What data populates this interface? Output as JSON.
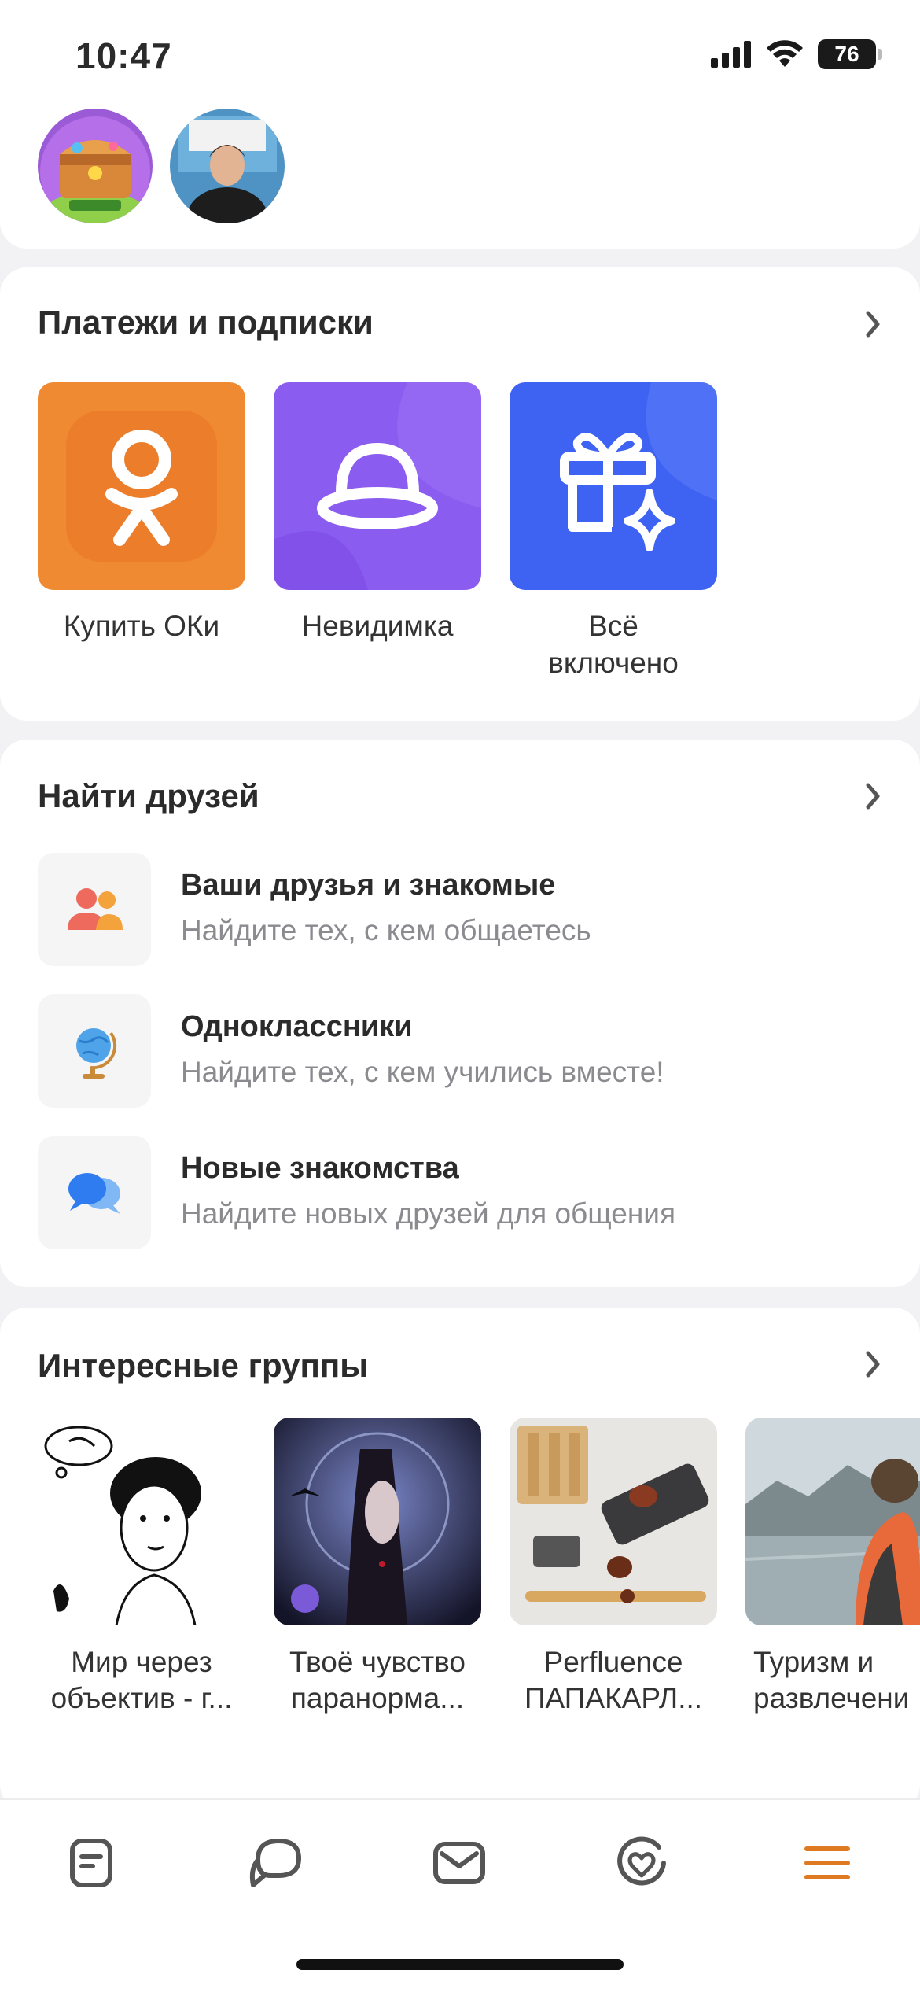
{
  "status_bar": {
    "time": "10:47",
    "battery": "76"
  },
  "payments": {
    "title": "Платежи и подписки",
    "items": [
      {
        "label": "Купить ОКи",
        "icon": "ok-logo-icon"
      },
      {
        "label": "Невидимка",
        "icon": "hat-icon"
      },
      {
        "label": "Всё включено",
        "icon": "gift-sparkle-icon"
      }
    ]
  },
  "friends": {
    "title": "Найти друзей",
    "items": [
      {
        "title": "Ваши друзья и знакомые",
        "subtitle": "Найдите тех, с кем общаетесь",
        "icon": "people-icon"
      },
      {
        "title": "Одноклассники",
        "subtitle": "Найдите тех, с кем учились вместе!",
        "icon": "globe-icon"
      },
      {
        "title": "Новые знакомства",
        "subtitle": "Найдите новых друзей для общения",
        "icon": "chat-bubbles-icon"
      }
    ]
  },
  "groups": {
    "title": "Интересные группы",
    "items": [
      {
        "line1": "Мир через",
        "line2": "объектив - г..."
      },
      {
        "line1": "Твоё чувство",
        "line2": "паранорма..."
      },
      {
        "line1": "Perfluence",
        "line2": "ПАПАКАРЛ..."
      },
      {
        "line1": "Туризм и",
        "line2": "развлечени"
      }
    ]
  },
  "tabbar": {
    "items": [
      "feed-icon",
      "discussions-icon",
      "messages-icon",
      "notifications-icon",
      "menu-icon"
    ],
    "active_color": "#e07a22",
    "inactive_color": "#555555"
  },
  "colors": {
    "accent": "#f08a32",
    "purple": "#8b5cf0",
    "blue": "#3e63f2"
  }
}
